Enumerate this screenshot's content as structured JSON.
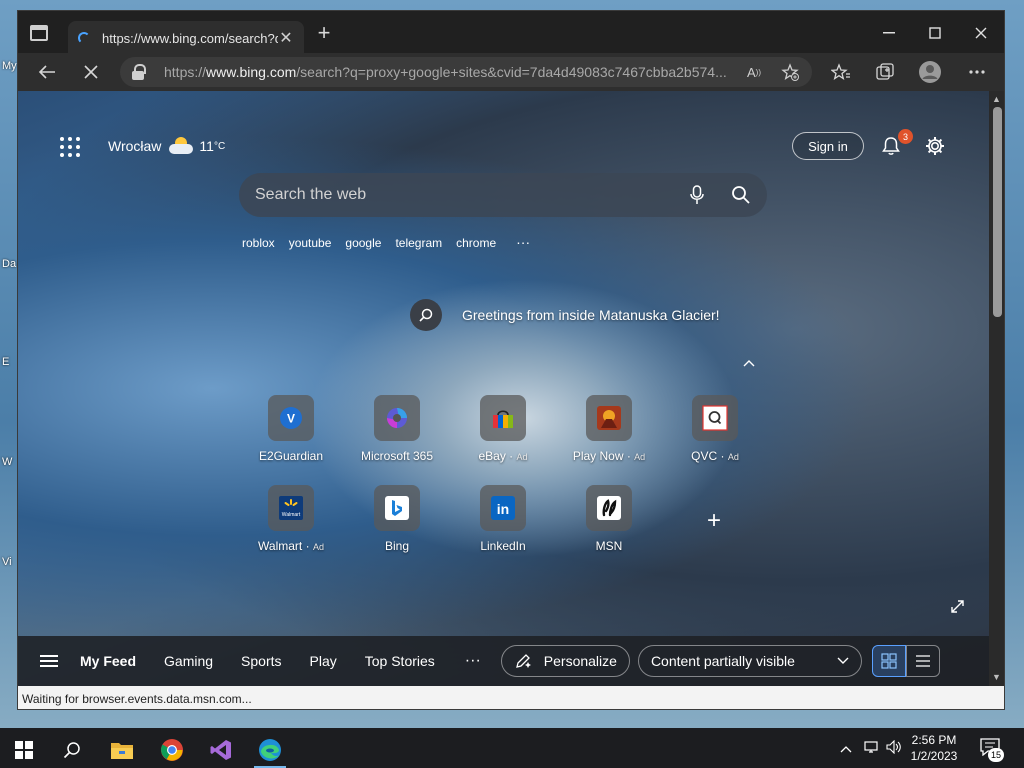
{
  "desktop": {
    "side_labels": [
      "My",
      "Da",
      "E",
      "W",
      "Vi"
    ]
  },
  "browser": {
    "tab": {
      "title": "https://www.bing.com/search?q="
    },
    "address": {
      "prefix": "https://",
      "host": "www.bing.com",
      "path": "/search?q=proxy+google+sites&cvid=7da4d49083c7467cbba2b574..."
    },
    "status_text": "Waiting for browser.events.data.msn.com..."
  },
  "page": {
    "location": "Wrocław",
    "temperature": "11",
    "temperature_unit": "°C",
    "sign_in_label": "Sign in",
    "notification_count": "3",
    "search_placeholder": "Search the web",
    "trending": [
      "roblox",
      "youtube",
      "google",
      "telegram",
      "chrome"
    ],
    "trending_more": "···",
    "greeting": "Greetings from inside Matanuska Glacier!",
    "tiles": [
      {
        "label": "E2Guardian",
        "ad": "",
        "icon": "e2guardian-icon"
      },
      {
        "label": "Microsoft 365",
        "ad": "",
        "icon": "microsoft-365-icon"
      },
      {
        "label": "eBay",
        "ad": "Ad",
        "icon": "ebay-icon"
      },
      {
        "label": "Play Now",
        "ad": "Ad",
        "icon": "play-now-icon"
      },
      {
        "label": "QVC",
        "ad": "Ad",
        "icon": "qvc-icon"
      },
      {
        "label": "Walmart",
        "ad": "Ad",
        "icon": "walmart-icon"
      },
      {
        "label": "Bing",
        "ad": "",
        "icon": "bing-icon"
      },
      {
        "label": "LinkedIn",
        "ad": "",
        "icon": "linkedin-icon"
      },
      {
        "label": "MSN",
        "ad": "",
        "icon": "msn-icon"
      }
    ],
    "feed": {
      "tabs": [
        "My Feed",
        "Gaming",
        "Sports",
        "Play",
        "Top Stories"
      ],
      "more": "···",
      "personalize_label": "Personalize",
      "content_visibility": "Content partially visible"
    }
  },
  "taskbar": {
    "time": "2:56 PM",
    "date": "1/2/2023",
    "notification_count": "15"
  },
  "colors": {
    "accent": "#76b9ed",
    "badge": "#e0532b",
    "linkedin": "#0a66c2"
  }
}
